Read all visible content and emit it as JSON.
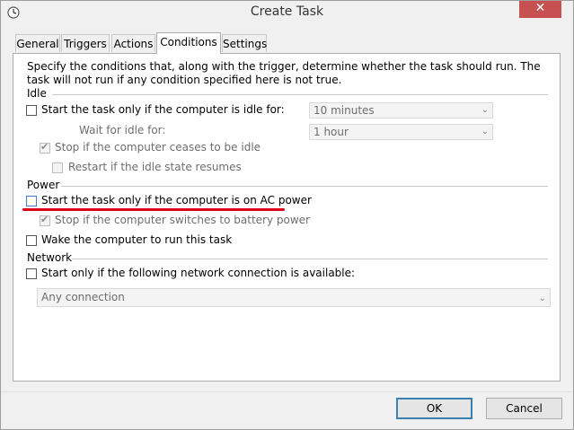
{
  "window": {
    "title": "Create Task",
    "close_glyph": "✕"
  },
  "tabs": [
    {
      "label": "General"
    },
    {
      "label": "Triggers"
    },
    {
      "label": "Actions"
    },
    {
      "label": "Conditions",
      "active": true
    },
    {
      "label": "Settings"
    }
  ],
  "description": "Specify the conditions that, along with the trigger, determine whether the task should run.  The task will not run  if any condition specified here is not true.",
  "idle": {
    "heading": "Idle",
    "start_if_idle": {
      "label": "Start the task only if the computer is idle for:",
      "checked": false
    },
    "idle_for_value": "10 minutes",
    "wait_label": "Wait for idle for:",
    "wait_value": "1 hour",
    "stop_if_ceases": {
      "label": "Stop if the computer ceases to be idle",
      "checked": true
    },
    "restart_if_resumes": {
      "label": "Restart if the idle state resumes",
      "checked": false
    }
  },
  "power": {
    "heading": "Power",
    "ac_power": {
      "label": "Start the task only if the computer is on AC power",
      "checked": false
    },
    "battery_stop": {
      "label": "Stop if the computer switches to battery power",
      "checked": true
    },
    "wake": {
      "label": "Wake the computer to run this task",
      "checked": false
    }
  },
  "network": {
    "heading": "Network",
    "start_if_network": {
      "label": "Start only if the following network connection is available:",
      "checked": false
    },
    "connection_value": "Any connection"
  },
  "buttons": {
    "ok": "OK",
    "cancel": "Cancel"
  },
  "colors": {
    "annotation_underline": "#e0001a",
    "default_button_border": "#3c7fb1",
    "close_button": "#c75050"
  }
}
